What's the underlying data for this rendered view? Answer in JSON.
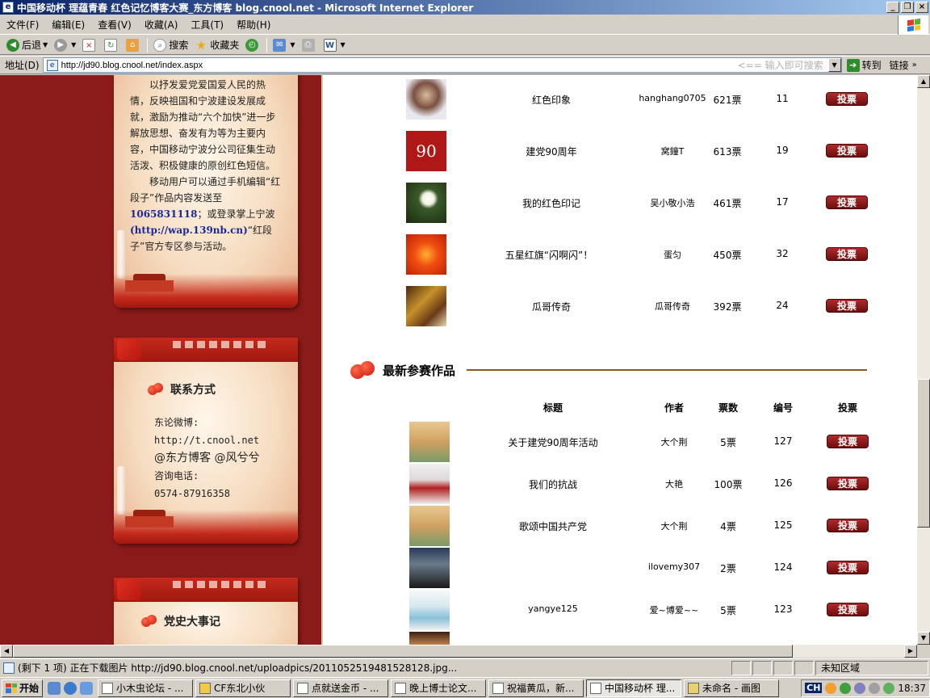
{
  "window": {
    "title": "中国移动杯 理蕴青春 红色记忆博客大赛_东方博客 blog.cnool.net - Microsoft Internet Explorer",
    "min": "_",
    "max": "❐",
    "close": "×"
  },
  "menu": [
    "文件(F)",
    "编辑(E)",
    "查看(V)",
    "收藏(A)",
    "工具(T)",
    "帮助(H)"
  ],
  "toolbar": {
    "back": "后退",
    "search": "搜索",
    "favorites": "收藏夹"
  },
  "address": {
    "label": "地址(D)",
    "url": "http://jd90.blog.cnool.net/index.aspx",
    "hint": "<== 输入即可搜索",
    "go": "转到",
    "links": "链接"
  },
  "left": {
    "intro": {
      "p1": "以抒发爱党爱国爱人民的热情，反映祖国和宁波建设发展成就，激励为推动“六个加快”进一步解放思想、奋发有为等为主要内容，中国移动宁波分公司征集生动活泼、积极健康的原创红色短信。",
      "p2a": "移动用户可以通过手机编辑“红段子”作品内容发送至",
      "phone": "1065831118",
      "p2b": "；或登录掌上宁波",
      "wap": "(http://wap.139nb.cn)",
      "p2c": "“红段子”官方专区参与活动。"
    },
    "contact": {
      "title": "联系方式",
      "weibo_label": "东论微博:",
      "weibo_url": "http://t.cnool.net",
      "accounts": "@东方博客 @风兮兮",
      "phone_label": "咨询电话:",
      "phone": "0574-87916358"
    },
    "history": {
      "title": "党史大事记"
    }
  },
  "top_entries": [
    {
      "title": "红色印象",
      "author": "hanghang0705",
      "votes": "621票",
      "id": "11",
      "vote": "投票"
    },
    {
      "title": "建党90周年",
      "author": "窝鐘T",
      "votes": "613票",
      "id": "19",
      "vote": "投票"
    },
    {
      "title": "我的红色印记",
      "author": "吴小敬小浩",
      "votes": "461票",
      "id": "17",
      "vote": "投票"
    },
    {
      "title": "五星红旗“闪啊闪”！",
      "author": "蛋匀",
      "votes": "450票",
      "id": "32",
      "vote": "投票"
    },
    {
      "title": "瓜哥传奇",
      "author": "瓜哥传奇",
      "votes": "392票",
      "id": "24",
      "vote": "投票"
    }
  ],
  "latest": {
    "title": "最新参赛作品",
    "headers": {
      "title": "标题",
      "author": "作者",
      "votes": "票数",
      "id": "编号",
      "vote": "投票"
    },
    "entries": [
      {
        "title": "关于建党90周年活动",
        "author": "大个荆",
        "votes": "5票",
        "id": "127",
        "vote": "投票"
      },
      {
        "title": "我们的抗战",
        "author": "大艳",
        "votes": "100票",
        "id": "126",
        "vote": "投票"
      },
      {
        "title": "歌颂中国共产党",
        "author": "大个荆",
        "votes": "4票",
        "id": "125",
        "vote": "投票"
      },
      {
        "title": "",
        "author": "ilovemy307",
        "votes": "2票",
        "id": "124",
        "vote": "投票"
      },
      {
        "title": "yangye125",
        "author": "爱~博爱~~",
        "votes": "5票",
        "id": "123",
        "vote": "投票"
      }
    ]
  },
  "status": {
    "text": "(剩下 1 项) 正在下载图片 http://jd90.blog.cnool.net/uploadpics/20110525194815281​28.jpg...",
    "zone": "未知区域"
  },
  "taskbar": {
    "start": "开始",
    "tasks": [
      "小木虫论坛 - ...",
      "CF东北小伙",
      "点就送金币 - ...",
      "晚上博士论文...",
      "祝福黄瓜，新...",
      "中国移动杯 理...",
      "未命名 - 画图"
    ],
    "lang": "CH",
    "clock": "18:37"
  }
}
